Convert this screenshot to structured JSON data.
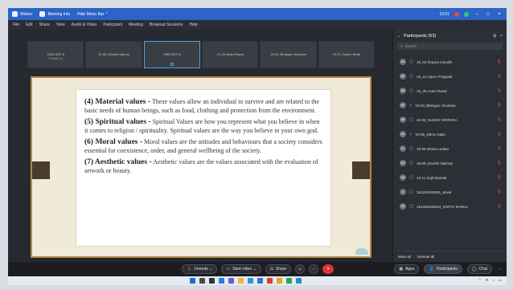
{
  "titlebar": {
    "items": [
      "Webex",
      "Meeting Info",
      "Hide Menu Bar"
    ],
    "time": "10:51"
  },
  "menubar": {
    "items": [
      "File",
      "Edit",
      "Share",
      "View",
      "Audio & Video",
      "Participant",
      "Meeting",
      "Breakout Sessions",
      "Help"
    ]
  },
  "thumbnails": [
    {
      "name": "CMS-DEF-8",
      "sub": "Cereals Inc"
    },
    {
      "name": "19-05_Darshit Nakum",
      "sub": ""
    },
    {
      "name": "CMS-DEF-8",
      "sub": "",
      "active": true
    },
    {
      "name": "19_25 Avani Raval",
      "sub": ""
    },
    {
      "name": "19-03_Bhargav choubisa",
      "sub": ""
    },
    {
      "name": "20-07_Sanni_Bhatt",
      "sub": ""
    }
  ],
  "slide": {
    "paragraphs": [
      {
        "heading": "(4) Material values -",
        "body": " These values allow an individual to survive and are related to the basic needs of human beings, such as food, clothing and protection from the environment."
      },
      {
        "heading": "(5) Spiritual values -",
        "body": " Spiritual Values are how you represent what you believe in when it comes to religion / spirituality. Spiritual values are the way you believe in your own god."
      },
      {
        "heading": "(6) Moral values -",
        "body": " Moral values are the attitudes and behaviours that a society considers essential for coexistence, order, and general wellbeing of the society."
      },
      {
        "heading": "(7) Aesthetic values -",
        "body": " Aesthetic values are the values associated with the evaluation of artwork or beauty."
      }
    ]
  },
  "participants": {
    "title": "Participants (53)",
    "search_placeholder": "Search",
    "list": [
      {
        "initials": "HA",
        "name": "19_03 hirpara Avirudh"
      },
      {
        "initials": "AP",
        "name": "19_21 Apurv Prajapati"
      },
      {
        "initials": "AR",
        "name": "19_25 Avani Raval"
      },
      {
        "initials": "BC",
        "name": "19-03_Bhargav choubisa"
      },
      {
        "initials": "SH",
        "name": "19-04_SUNNY HIRPARA"
      },
      {
        "initials": "DK",
        "name": "19-05_Dhruv Kaila"
      },
      {
        "initials": "DL",
        "name": "19-09 Dhara Ledani"
      },
      {
        "initials": "DN",
        "name": "19-09_Darshit Nakrani"
      },
      {
        "initials": "SM",
        "name": "19-11 Sujit Mandal"
      },
      {
        "initials": "D",
        "name": "191200105001_deval"
      },
      {
        "initials": "PR",
        "name": "191200105024_PARTH RAWAL"
      }
    ],
    "footer": {
      "mute_all": "Mute all",
      "unmute_all": "Unmute all"
    }
  },
  "controls": {
    "unmute": "Unmute",
    "start_video": "Start video",
    "share": "Share",
    "apps": "Apps",
    "participants": "Participants",
    "chat": "Chat"
  },
  "colors": {
    "titlebar": "#2b63c6",
    "end_call": "#e0323a",
    "muted_icon": "#e05050",
    "active_thumb_border": "#4aa3e8"
  }
}
